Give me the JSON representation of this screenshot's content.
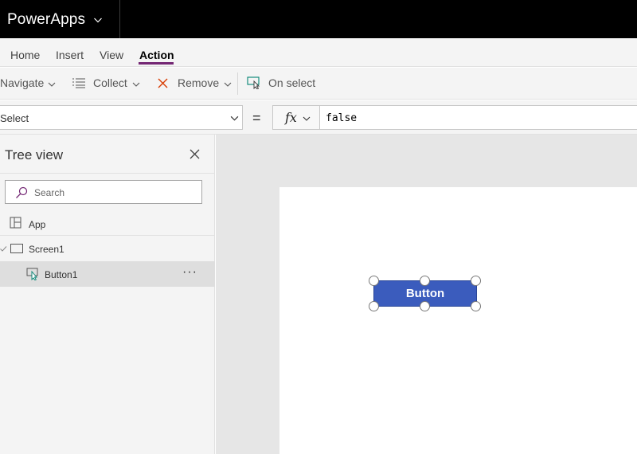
{
  "header": {
    "app_name": "PowerApps"
  },
  "menu": {
    "tabs": [
      "Home",
      "Insert",
      "View",
      "Action"
    ],
    "active_tab": "Action",
    "accent": "#742774"
  },
  "toolbar": {
    "navigate_label": "Navigate",
    "collect_label": "Collect",
    "remove_label": "Remove",
    "onselect_label": "On select"
  },
  "formula": {
    "property_value": "Select",
    "equals": "=",
    "fx_label": "fx",
    "value": "false"
  },
  "treeview": {
    "title": "Tree view",
    "search_placeholder": "Search",
    "items": [
      {
        "label": "App",
        "icon": "app-icon"
      },
      {
        "label": "Screen1",
        "icon": "screen-icon"
      },
      {
        "label": "Button1",
        "icon": "button-icon",
        "selected": true
      }
    ],
    "more": "···"
  },
  "canvas": {
    "button_label": "Button",
    "button_color": "#3b5cbd"
  }
}
